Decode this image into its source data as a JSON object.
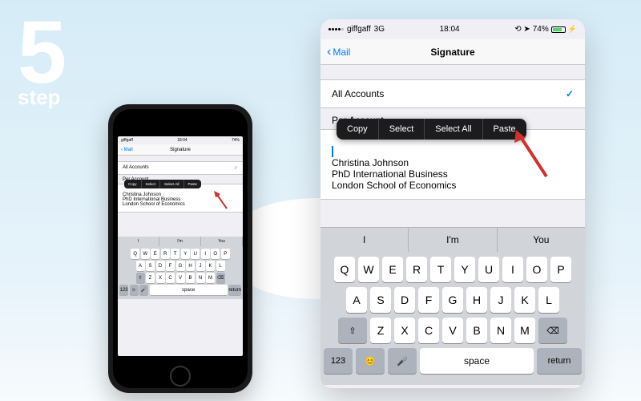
{
  "step": {
    "number": "5",
    "label": "step"
  },
  "status": {
    "carrier": "giffgaff",
    "network": "3G",
    "time": "18:04",
    "battery": "74%"
  },
  "nav": {
    "back": "Mail",
    "title": "Signature"
  },
  "rows": {
    "all_accounts": "All Accounts",
    "per_account": "Per Account"
  },
  "context_menu": [
    "Copy",
    "Select",
    "Select All",
    "Paste"
  ],
  "signature": {
    "line1": "Christina Johnson",
    "line2": "PhD International Business",
    "line3": "London School of Economics"
  },
  "suggestions": [
    "I",
    "I'm",
    "You"
  ],
  "keyboard": {
    "r1": [
      "Q",
      "W",
      "E",
      "R",
      "T",
      "Y",
      "U",
      "I",
      "O",
      "P"
    ],
    "r2": [
      "A",
      "S",
      "D",
      "F",
      "G",
      "H",
      "J",
      "K",
      "L"
    ],
    "r3": [
      "Z",
      "X",
      "C",
      "V",
      "B",
      "N",
      "M"
    ],
    "num": "123",
    "space": "space",
    "return": "return"
  }
}
